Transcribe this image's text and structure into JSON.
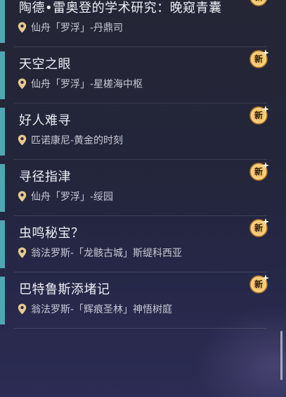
{
  "badge_label": "新",
  "quests": [
    {
      "title": "陶德•雷奥登的学术研究：晚窥青囊",
      "location": "仙舟「罗浮」-丹鼎司"
    },
    {
      "title": "天空之眼",
      "location": "仙舟「罗浮」-星槎海中枢"
    },
    {
      "title": "好人难寻",
      "location": "匹诺康尼-黄金的时刻"
    },
    {
      "title": "寻径指津",
      "location": "仙舟「罗浮」-绥园"
    },
    {
      "title": "虫鸣秘宝？",
      "location": "翁法罗斯-「龙骸古城」斯缇科西亚"
    },
    {
      "title": "巴特鲁斯添堵记",
      "location": "翁法罗斯-「辉痕圣林」神悟树庭"
    }
  ]
}
